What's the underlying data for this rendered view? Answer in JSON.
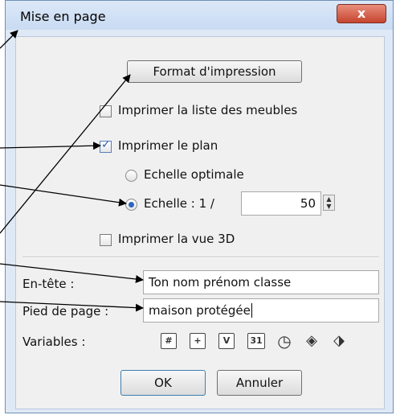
{
  "dialog": {
    "title": "Mise en page",
    "close_label": "x"
  },
  "format_button": "Format d'impression",
  "options": {
    "print_furniture": {
      "label": "Imprimer la liste des meubles",
      "checked": false
    },
    "print_plan": {
      "label": "Imprimer le plan",
      "checked": true
    },
    "scale_optimal": {
      "label": "Echelle optimale",
      "selected": false
    },
    "scale_fixed": {
      "label": "Echelle : 1 /",
      "selected": true,
      "value": "50"
    },
    "print_3d": {
      "label": "Imprimer la vue 3D",
      "checked": false
    }
  },
  "header": {
    "label": "En-tête :",
    "value": "Ton nom prénom classe"
  },
  "footer": {
    "label": "Pied de page :",
    "value": "maison protégée"
  },
  "variables": {
    "label": "Variables :",
    "icons": [
      "hash-icon",
      "plus-hash-icon",
      "version-icon",
      "calendar-31-icon",
      "clock-icon",
      "diamond-tag-icon",
      "cube-tag-icon"
    ]
  },
  "buttons": {
    "ok": "OK",
    "cancel": "Annuler"
  },
  "colors": {
    "arrow": "#000000",
    "check_accent": "#2a5fc0",
    "close_button": "#c6442e"
  }
}
